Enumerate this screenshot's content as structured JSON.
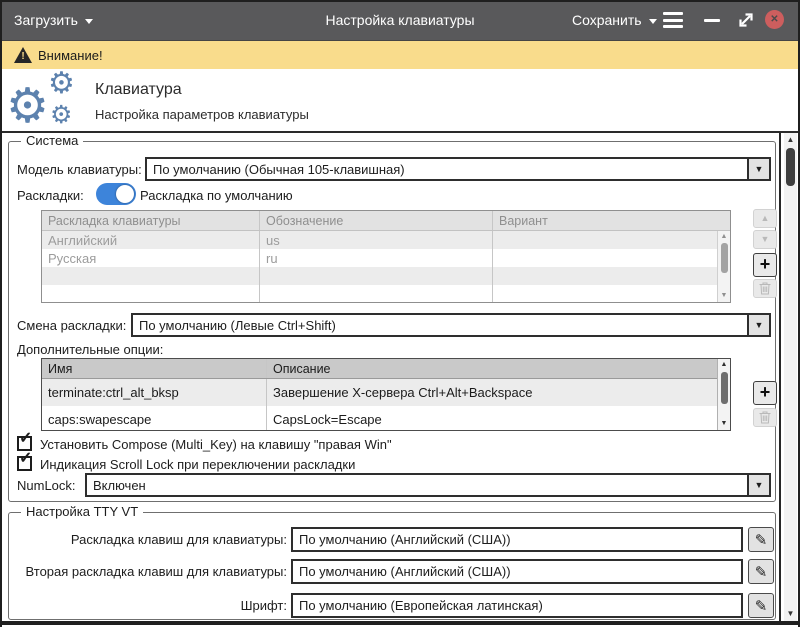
{
  "titlebar": {
    "load_label": "Загрузить",
    "title": "Настройка клавиатуры",
    "save_label": "Сохранить"
  },
  "warning_bar": {
    "text": "Внимание!"
  },
  "page_header": {
    "title": "Клавиатура",
    "subtitle": "Настройка параметров клавиатуры"
  },
  "system": {
    "legend": "Система",
    "model": {
      "label": "Модель клавиатуры:",
      "value": "По умолчанию (Обычная 105-клавишная)"
    },
    "layouts": {
      "label": "Раскладки:",
      "toggle_text": "Раскладка по умолчанию",
      "table": {
        "headers": [
          "Раскладка клавиатуры",
          "Обозначение",
          "Вариант"
        ],
        "rows": [
          [
            "Английский",
            "us",
            ""
          ],
          [
            "Русская",
            "ru",
            ""
          ]
        ]
      }
    },
    "switch": {
      "label": "Смена раскладки:",
      "value": "По умолчанию (Левые Ctrl+Shift)"
    },
    "options": {
      "label": "Дополнительные опции:",
      "table": {
        "headers": [
          "Имя",
          "Описание"
        ],
        "rows": [
          [
            "terminate:ctrl_alt_bksp",
            "Завершение X-сервера Ctrl+Alt+Backspace"
          ],
          [
            "caps:swapescape",
            "CapsLock=Escape"
          ]
        ]
      }
    },
    "checkbox_compose": "Установить Compose (Multi_Key) на клавишу \"правая Win\"",
    "checkbox_scrolllock": "Индикация Scroll Lock при переключении раскладки",
    "numlock": {
      "label": "NumLock:",
      "value": "Включен"
    }
  },
  "tty": {
    "legend": "Настройка TTY VT",
    "rows": [
      {
        "label": "Раскладка клавиш для клавиатуры:",
        "value": "По умолчанию (Английский (США))"
      },
      {
        "label": "Вторая раскладка клавиш для клавиатуры:",
        "value": "По умолчанию (Английский (США))"
      },
      {
        "label": "Шрифт:",
        "value": "По умолчанию (Европейская латинская)"
      }
    ]
  },
  "icons": {
    "gear": "⚙",
    "check": "✓",
    "plus": "+",
    "up_arrow": "▲",
    "down_arrow": "▼",
    "combo_arrow": "▼",
    "pencil": "✎",
    "close": "✕",
    "warning_exclamation": "!"
  },
  "colors": {
    "titlebar_bg": "#59595b",
    "warning_bg": "#f9dc8c",
    "toggle_blue": "#3d84da",
    "gear_blue": "#5d82ae",
    "close_red": "#cd5e5e"
  }
}
